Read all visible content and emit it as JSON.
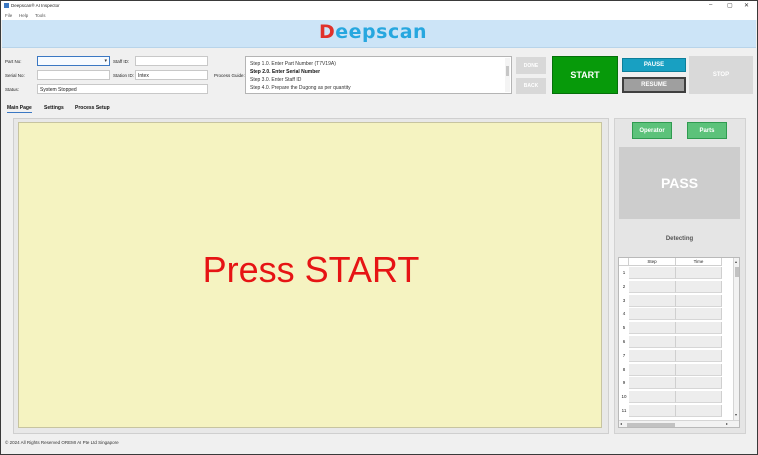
{
  "window": {
    "title": "Deepscan® AI Inspector",
    "minimize_glyph": "–",
    "maximize_glyph": "▢",
    "close_glyph": "✕"
  },
  "menu": [
    "File",
    "Help",
    "Tools"
  ],
  "logo": {
    "first_letter": "D",
    "rest": "eepscan",
    "colors": {
      "first": "#e0312b",
      "rest": "#27a7df"
    }
  },
  "form": {
    "part_no": {
      "label": "Part No:",
      "value": ""
    },
    "serial_no": {
      "label": "Serial No:",
      "value": ""
    },
    "status": {
      "label": "Status:",
      "value": "System Stopped"
    },
    "staff_id": {
      "label": "Staff ID:",
      "value": ""
    },
    "station_id": {
      "label": "Station ID:",
      "value": "Intex"
    },
    "process_guide_label": "Process Guide:"
  },
  "process_guide": [
    {
      "text": "Step 1.0. Enter Part Number (T7V19A)",
      "bold": false
    },
    {
      "text": "Step 2.0. Enter Serial Number",
      "bold": true
    },
    {
      "text": "Step 3.0. Enter Staff ID",
      "bold": false
    },
    {
      "text": "Step 4.0. Prepare the Dugong as per quantity",
      "bold": false
    }
  ],
  "buttons": {
    "done": "DONE",
    "back": "BACK",
    "start": "START",
    "pause": "PAUSE",
    "resume": "RESUME",
    "stop": "STOP",
    "operator": "Operator",
    "parts": "Parts"
  },
  "tabs": [
    "Main Page",
    "Settings",
    "Process Setup"
  ],
  "active_tab": "Main Page",
  "main": {
    "prompt": "Press START"
  },
  "result": {
    "value": "PASS",
    "detecting": "Detecting"
  },
  "grid": {
    "columns": [
      "Step",
      "Time"
    ],
    "row_numbers": [
      "1",
      "2",
      "3",
      "4",
      "5",
      "6",
      "7",
      "8",
      "9",
      "10",
      "11"
    ]
  },
  "footer": "© 2024 All Rights Reserved OREMI AI Pte Ltd Singapore",
  "colors": {
    "banner": "#cce4f7",
    "start": "#079a0a",
    "pause": "#18a0c2",
    "resume": "#9f9f9f",
    "operator": "#5cc27a",
    "prompt": "#e61414",
    "canvas": "#f5f3c1"
  }
}
